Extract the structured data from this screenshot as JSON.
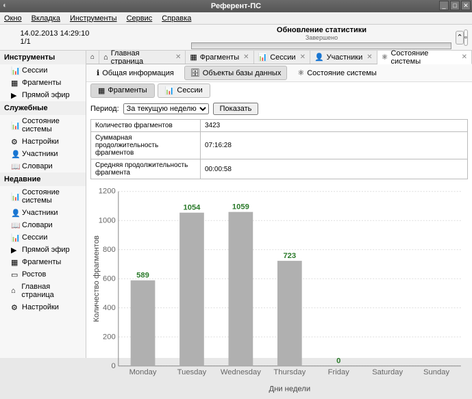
{
  "app": {
    "title": "Референт-ПС"
  },
  "menubar": [
    "Окно",
    "Вкладка",
    "Инструменты",
    "Сервис",
    "Справка"
  ],
  "toolbar": {
    "datetime": "14.02.2013  14:29:10",
    "count": "1/1",
    "status_title": "Обновление статистики",
    "status_sub": "Завершено"
  },
  "sidebar": {
    "groups": [
      {
        "title": "Инструменты",
        "items": [
          {
            "icon": "chart",
            "label": "Сессии"
          },
          {
            "icon": "frag",
            "label": "Фрагменты"
          },
          {
            "icon": "live",
            "label": "Прямой эфир"
          }
        ]
      },
      {
        "title": "Служебные",
        "items": [
          {
            "icon": "chart",
            "label": "Состояние системы"
          },
          {
            "icon": "gear",
            "label": "Настройки"
          },
          {
            "icon": "user",
            "label": "Участники"
          },
          {
            "icon": "book",
            "label": "Словари"
          }
        ]
      },
      {
        "title": "Недавние",
        "items": [
          {
            "icon": "chart",
            "label": "Состояние системы"
          },
          {
            "icon": "user",
            "label": "Участники"
          },
          {
            "icon": "book",
            "label": "Словари"
          },
          {
            "icon": "chart",
            "label": "Сессии"
          },
          {
            "icon": "live",
            "label": "Прямой эфир"
          },
          {
            "icon": "frag",
            "label": "Фрагменты"
          },
          {
            "icon": "page",
            "label": "Ростов"
          },
          {
            "icon": "home",
            "label": "Главная страница"
          },
          {
            "icon": "gear",
            "label": "Настройки"
          }
        ]
      }
    ]
  },
  "tabs": [
    {
      "icon": "home",
      "label": "Главная страница"
    },
    {
      "icon": "frag",
      "label": "Фрагменты"
    },
    {
      "icon": "chart",
      "label": "Сессии"
    },
    {
      "icon": "user",
      "label": "Участники"
    },
    {
      "icon": "sys",
      "label": "Состояние системы",
      "active": true
    }
  ],
  "subtoolbar": [
    {
      "icon": "info",
      "label": "Общая информация",
      "style": "plain"
    },
    {
      "icon": "db",
      "label": "Объекты базы данных",
      "style": "grey"
    },
    {
      "icon": "sys",
      "label": "Состояние системы",
      "style": "plain"
    }
  ],
  "subtabs": [
    {
      "icon": "frag",
      "label": "Фрагменты",
      "active": true
    },
    {
      "icon": "chart",
      "label": "Сессии"
    }
  ],
  "period": {
    "label": "Период:",
    "select": "За текущую неделю",
    "button": "Показать"
  },
  "stats_rows": [
    [
      "Количество фрагментов",
      "3423"
    ],
    [
      "Суммарная продолжительность фрагментов",
      "07:16:28"
    ],
    [
      "Средняя продолжительность фрагмента",
      "00:00:58"
    ]
  ],
  "chart_data": {
    "type": "bar",
    "categories": [
      "Monday",
      "Tuesday",
      "Wednesday",
      "Thursday",
      "Friday",
      "Saturday",
      "Sunday"
    ],
    "values": [
      589,
      1054,
      1059,
      723,
      0,
      null,
      null
    ],
    "title": "",
    "xlabel": "Дни недели",
    "ylabel": "Количество фрагментов",
    "ylim": [
      0,
      1200
    ],
    "yticks": [
      0,
      200,
      400,
      600,
      800,
      1000,
      1200
    ],
    "bar_color": "#b0b0b0",
    "label_color": "#2a7a2a"
  }
}
